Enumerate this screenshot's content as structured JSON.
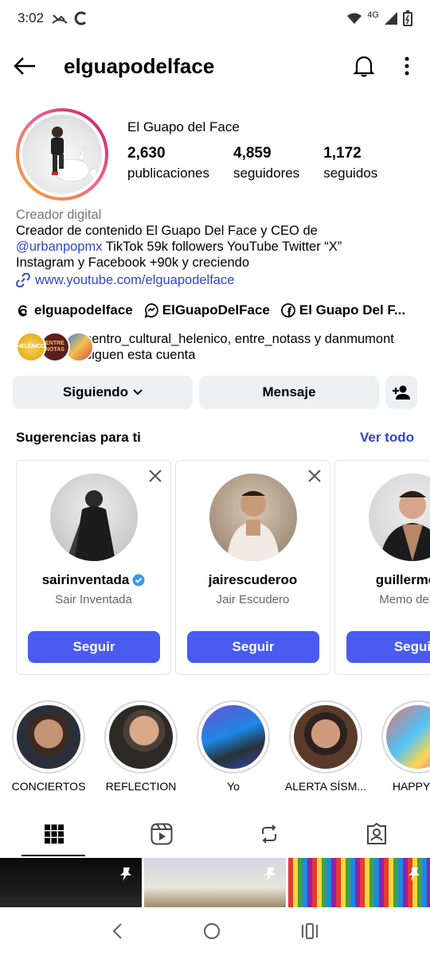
{
  "status": {
    "time": "3:02",
    "network": "4G"
  },
  "header": {
    "username": "elguapodelface"
  },
  "profile": {
    "display_name": "El Guapo del Face",
    "stats": [
      {
        "value": "2,630",
        "label": "publicaciones"
      },
      {
        "value": "4,859",
        "label": "seguidores"
      },
      {
        "value": "1,172",
        "label": "seguidos"
      }
    ]
  },
  "bio": {
    "category": "Creador digital",
    "line1": "Creador de contenido El Guapo Del Face y CEO de",
    "mention": "@urbanpopmx",
    "line2_rest": " TikTok 59k followers YouTube Twitter “X”",
    "line3": "Instagram y Facebook +90k y creciendo",
    "link": "www.youtube.com/elguapodelface"
  },
  "socials": [
    {
      "label": "elguapodelface",
      "icon": "threads-icon"
    },
    {
      "label": "ElGuapoDelFace",
      "icon": "messenger-icon"
    },
    {
      "label": "El Guapo Del F...",
      "icon": "facebook-icon"
    }
  ],
  "followed_by": {
    "text": "centro_cultural_helenico, entre_notass y danmumont siguen esta cuenta",
    "avatar1_text": "HELÉNICO",
    "avatar2_text": "ENTRE NOTAS"
  },
  "buttons": {
    "following": "Siguiendo",
    "message": "Mensaje"
  },
  "suggestions": {
    "title": "Sugerencias para ti",
    "see_all": "Ver todo",
    "cards": [
      {
        "username": "sairinventada",
        "name": "Sair Inventada",
        "verified": true,
        "button": "Seguir"
      },
      {
        "username": "jairescuderoo",
        "name": "Jair Escudero",
        "verified": false,
        "button": "Seguir"
      },
      {
        "username": "guillermo.d",
        "name": "Memo del M",
        "verified": false,
        "button": "Segui"
      }
    ]
  },
  "highlights": [
    {
      "label": "CONCIERTOS"
    },
    {
      "label": "REFLECTION"
    },
    {
      "label": "Yo"
    },
    {
      "label": "ALERTA SÍSM..."
    },
    {
      "label": "HAPPY BI"
    }
  ],
  "colors": {
    "accent": "#4a5bf0",
    "link": "#3046c8",
    "ring_start": "#f9a825",
    "ring_end": "#c2185b"
  }
}
